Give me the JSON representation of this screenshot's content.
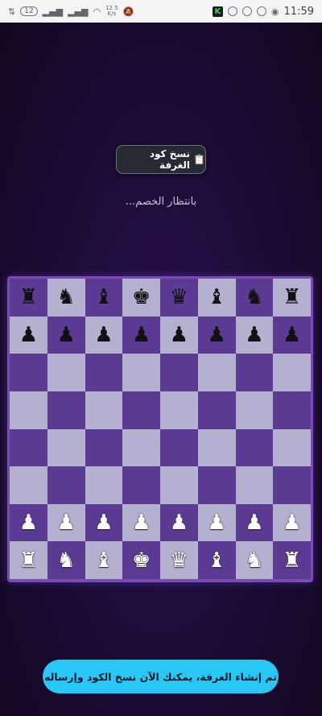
{
  "status_bar": {
    "battery": "12",
    "net_speed_value": "12.5",
    "net_speed_unit": "K/s",
    "app_badge": "K",
    "time": "11:59"
  },
  "copy_button": {
    "icon": "clipboard-icon",
    "label": "نسخ كود الغرفة"
  },
  "waiting_text": "بانتظار الخصم...",
  "board": {
    "colors": {
      "light": "#b3b1cf",
      "dark": "#5b3a94",
      "frame": "#7a4bb5"
    },
    "ranks": [
      [
        "br",
        "bn",
        "bb",
        "bk",
        "bq",
        "bb",
        "bn",
        "br"
      ],
      [
        "bp",
        "bp",
        "bp",
        "bp",
        "bp",
        "bp",
        "bp",
        "bp"
      ],
      [
        "",
        "",
        "",
        "",
        "",
        "",
        "",
        ""
      ],
      [
        "",
        "",
        "",
        "",
        "",
        "",
        "",
        ""
      ],
      [
        "",
        "",
        "",
        "",
        "",
        "",
        "",
        ""
      ],
      [
        "",
        "",
        "",
        "",
        "",
        "",
        "",
        ""
      ],
      [
        "wp",
        "wp",
        "wp",
        "wp",
        "wp",
        "wp",
        "wp",
        "wp"
      ],
      [
        "wr",
        "wn",
        "wb",
        "wk",
        "wq",
        "wb",
        "wn",
        "wr"
      ]
    ]
  },
  "toast": {
    "text": "تم إنشاء الغرفة، يمكنك الآن نسخ الكود وإرساله"
  }
}
